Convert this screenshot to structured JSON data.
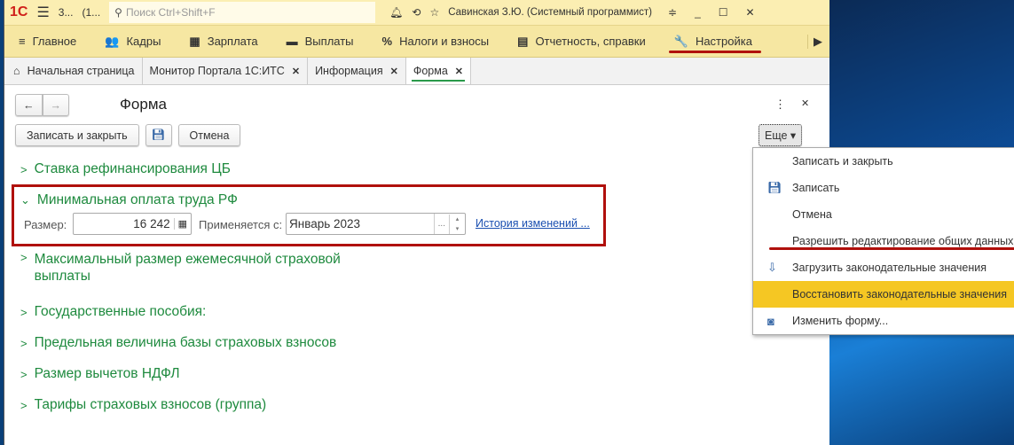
{
  "titlebar": {
    "logo": "1С",
    "title_short": "3...",
    "title_num": "(1...",
    "search_placeholder": "Поиск Ctrl+Shift+F",
    "user": "Савинская З.Ю. (Системный программист)"
  },
  "sections": [
    {
      "icon": "≡",
      "label": "Главное"
    },
    {
      "icon": "👥",
      "label": "Кадры"
    },
    {
      "icon": "▦",
      "label": "Зарплата"
    },
    {
      "icon": "▬",
      "label": "Выплаты"
    },
    {
      "icon": "%",
      "label": "Налоги и взносы"
    },
    {
      "icon": "▤",
      "label": "Отчетность, справки"
    },
    {
      "icon": "🔧",
      "label": "Настройка"
    }
  ],
  "tabs": [
    {
      "label": "Начальная страница"
    },
    {
      "label": "Монитор Портала 1С:ИТС"
    },
    {
      "label": "Информация"
    },
    {
      "label": "Форма"
    }
  ],
  "form": {
    "title": "Форма",
    "save_close": "Записать и закрыть",
    "cancel": "Отмена",
    "more": "Еще",
    "groups": [
      "Ставка рефинансирования ЦБ",
      "Минимальная оплата труда РФ",
      "Максимальный размер ежемесячной страховой",
      "выплаты",
      "Государственные пособия:",
      "Предельная величина базы страховых взносов",
      "Размер вычетов НДФЛ",
      "Тарифы страховых взносов (группа)"
    ],
    "size_label": "Размер:",
    "size_value": "16 242",
    "applies_label": "Применяется с:",
    "applies_value": "Январь 2023",
    "ellipsis": "...",
    "history_link": "История изменений ..."
  },
  "menu": [
    "Записать и закрыть",
    "Записать",
    "Отмена",
    "Разрешить редактирование общих данных",
    "Загрузить законодательные значения",
    "Восстановить законодательные значения",
    "Изменить форму..."
  ]
}
